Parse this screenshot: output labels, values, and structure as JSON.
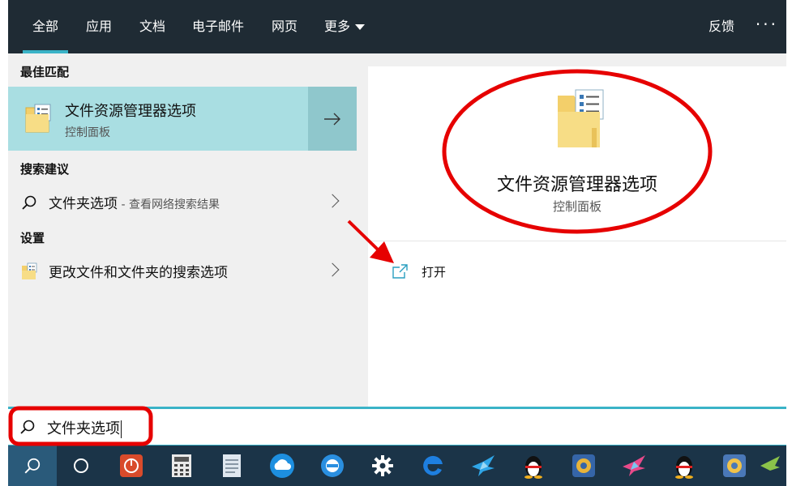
{
  "nav": {
    "tabs": [
      "全部",
      "应用",
      "文档",
      "电子邮件",
      "网页",
      "更多"
    ],
    "feedback": "反馈",
    "more_dots": "···"
  },
  "left": {
    "best_match_title": "最佳匹配",
    "best_match": {
      "title": "文件资源管理器选项",
      "subtitle": "控制面板"
    },
    "search_suggestions_title": "搜索建议",
    "suggestion": {
      "text": "文件夹选项",
      "hint": " - 查看网络搜索结果"
    },
    "settings_title": "设置",
    "setting": {
      "text": "更改文件和文件夹的搜索选项"
    }
  },
  "detail": {
    "title": "文件资源管理器选项",
    "subtitle": "控制面板",
    "open_label": "打开"
  },
  "search": {
    "value": "文件夹选项"
  },
  "taskbar": {
    "icons": [
      "search-icon",
      "task-view-icon",
      "power-app-icon",
      "calculator-icon",
      "notepad-icon",
      "cloud-app-icon",
      "ie-browser-icon",
      "settings-gear-icon",
      "edge-browser-icon",
      "bird-app-icon",
      "qq-penguin-icon",
      "media-app-icon",
      "bird-app-icon-2",
      "qq-penguin-icon-2",
      "media-app-icon-2",
      "more-app-icon"
    ]
  },
  "colors": {
    "accent": "#3ab3c7",
    "nav_bg": "#1f2b34",
    "highlight": "#a9dee2",
    "annotation_red": "#e60000"
  }
}
